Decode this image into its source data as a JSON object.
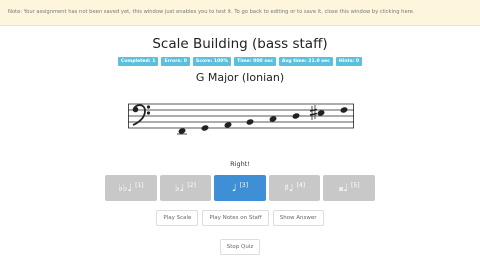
{
  "notice": "Note: Your assignment has not been saved yet, this window just enables you to test it. To go back to editing or to save it, close this window by clicking here.",
  "exercise": {
    "title": "Scale Building (bass staff)",
    "subtitle": "G Major (Ionian)",
    "stats": [
      "Completed: 1",
      "Errors: 0",
      "Score: 100%",
      "Time: 000 sec",
      "Avg time: 21.0 sec",
      "Hints: 0"
    ]
  },
  "feedback": "Right!",
  "answers": [
    {
      "symbol": "♭♭♩",
      "num": "[1]",
      "selected": false
    },
    {
      "symbol": "♭♩",
      "num": "[2]",
      "selected": false
    },
    {
      "symbol": "♩",
      "num": "[3]",
      "selected": true
    },
    {
      "symbol": "♯♩",
      "num": "[4]",
      "selected": false
    },
    {
      "symbol": "𝄪♩",
      "num": "[5]",
      "selected": false
    }
  ],
  "controls": {
    "play_scale": "Play Scale",
    "play_notes": "Play Notes on Staff",
    "show_answer": "Show Answer",
    "stop_quiz": "Stop Quiz"
  },
  "staff": {
    "clef": "bass-clef-icon",
    "notes": [
      "G2",
      "A2",
      "B2",
      "C3",
      "D3",
      "E3",
      "F#3",
      "G3"
    ]
  }
}
